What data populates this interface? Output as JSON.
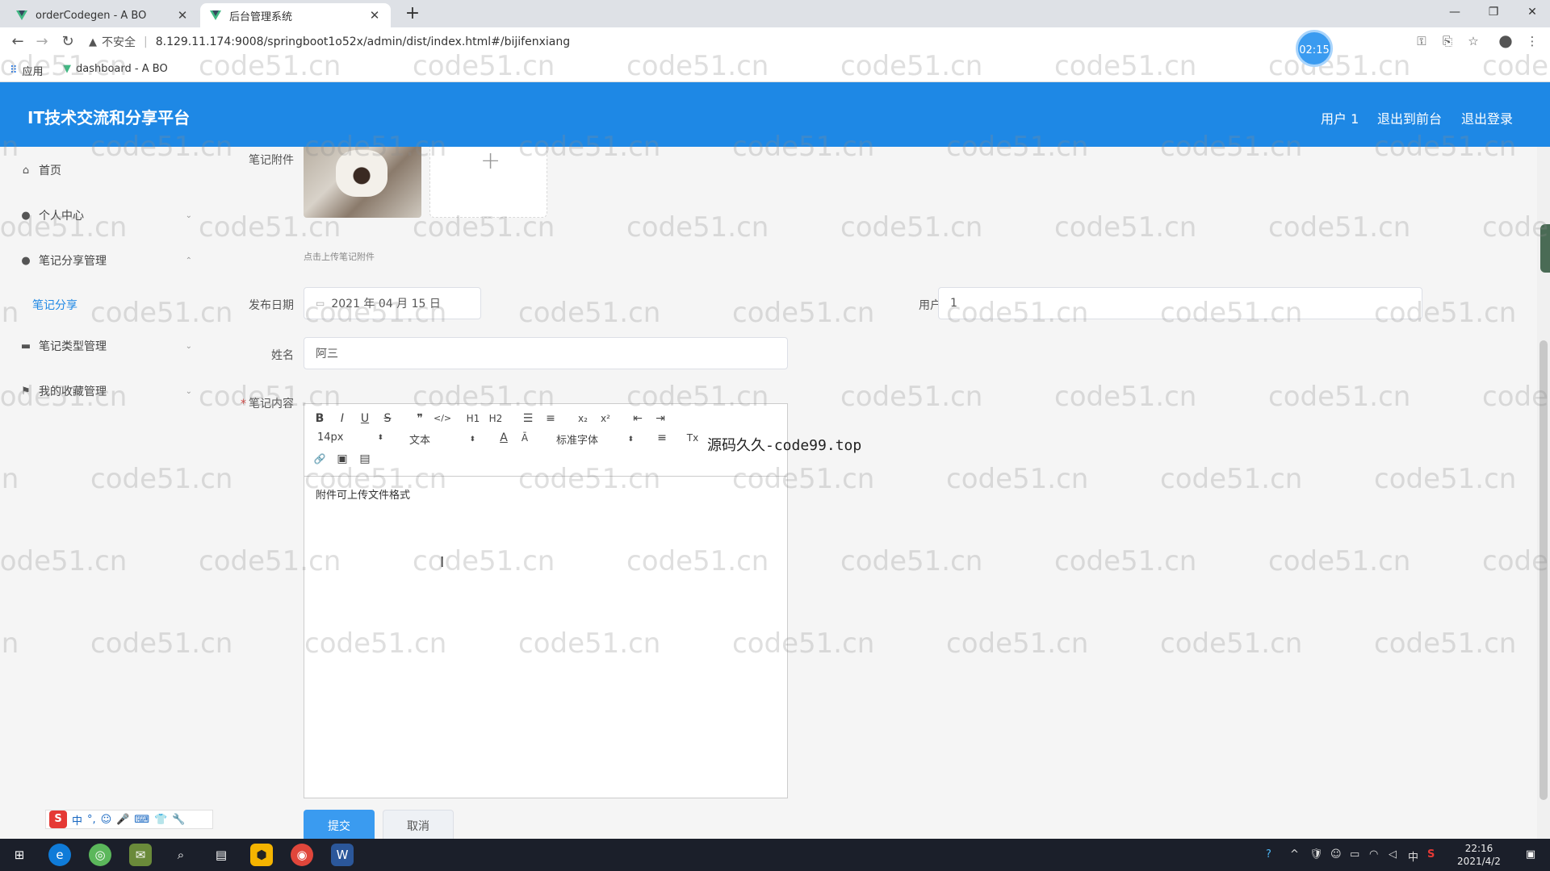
{
  "browser": {
    "tabs": [
      {
        "label": "orderCodegen - A BO",
        "close": "✕"
      },
      {
        "label": "后台管理系统",
        "close": "✕"
      }
    ],
    "new_tab": "+",
    "window_controls": [
      "—",
      "❐",
      "✕"
    ],
    "security_label": "不安全",
    "url": "8.129.11.174:9008/springboot1o52x/admin/dist/index.html#/bijifenxiang",
    "timer_badge": "02:15",
    "bookmarks": [
      {
        "label": "应用",
        "icon": "apps-grid-icon"
      },
      {
        "label": "dashboard - A BO",
        "icon": "vue-logo-icon"
      }
    ]
  },
  "header": {
    "title": "IT技术交流和分享平台",
    "user": "用户 1",
    "to_front": "退出到前台",
    "logout": "退出登录"
  },
  "sidebar": {
    "items": [
      {
        "label": "首页",
        "icon": "home-icon"
      },
      {
        "label": "个人中心",
        "icon": "user-icon"
      },
      {
        "label": "笔记分享管理",
        "icon": "user-icon"
      },
      {
        "label": "笔记类型管理",
        "icon": "monitor-icon"
      },
      {
        "label": "我的收藏管理",
        "icon": "flag-icon"
      }
    ],
    "active_subitem": "笔记分享"
  },
  "form": {
    "attachment_label": "笔记附件",
    "upload_tip": "点击上传笔记附件",
    "date_label": "发布日期",
    "date_value": "2021 年 04 月 15 日",
    "username_label": "用户名",
    "username_value": "1",
    "name_label": "姓名",
    "name_value": "阿三",
    "content_label": "笔记内容",
    "required_mark": "*",
    "content_text": "附件可上传文件格式",
    "submit": "提交",
    "cancel": "取消"
  },
  "editor": {
    "font_size": "14px",
    "header_select": "文本",
    "font_family": "标准字体",
    "buttons_row1": [
      "B",
      "I",
      "U",
      "S",
      "❞",
      "</>",
      "H1",
      "H2",
      "☰",
      "≡",
      "x₂",
      "x²",
      "⇤",
      "⇥"
    ],
    "buttons_row2_icons": [
      "A",
      "Ā",
      "≡",
      "Tx"
    ],
    "buttons_row3": [
      "🔗",
      "▣",
      "▤"
    ]
  },
  "overlay_text": "源码久久-code99.top",
  "watermark": "code51.cn",
  "ime": {
    "logo": "S",
    "items": [
      "中",
      "°,",
      "☺",
      "🎤",
      "⌨",
      "👕",
      "🔧"
    ]
  },
  "taskbar": {
    "clock_time": "22:16",
    "clock_date": "2021/4/2",
    "tray": [
      "?",
      "^",
      "🛡",
      "中",
      "S"
    ]
  },
  "colors": {
    "header_blue": "#1e88e5",
    "primary_button": "#3a9bf0",
    "submenu_active": "#1e88e5"
  }
}
